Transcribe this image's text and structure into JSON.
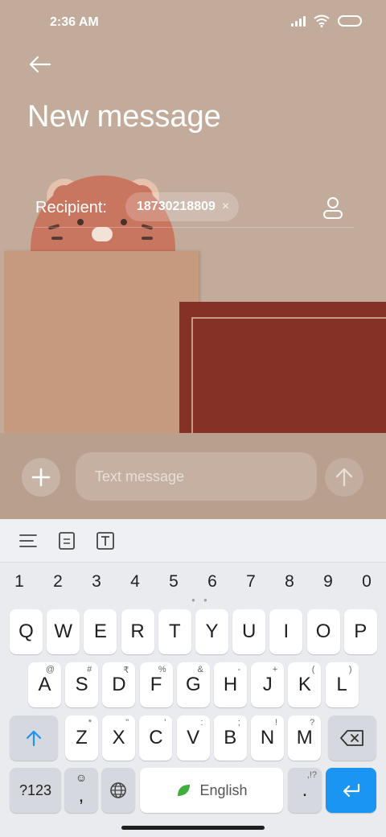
{
  "status_bar": {
    "time": "2:36 AM"
  },
  "header": {
    "title": "New message"
  },
  "recipient": {
    "label": "Recipient:",
    "chip_number": "18730218809",
    "chip_remove": "×"
  },
  "compose": {
    "placeholder": "Text message"
  },
  "keyboard": {
    "numbers": [
      "1",
      "2",
      "3",
      "4",
      "5",
      "6",
      "7",
      "8",
      "9",
      "0"
    ],
    "row1": [
      {
        "label": "Q"
      },
      {
        "label": "W"
      },
      {
        "label": "E"
      },
      {
        "label": "R"
      },
      {
        "label": "T"
      },
      {
        "label": "Y"
      },
      {
        "label": "U"
      },
      {
        "label": "I"
      },
      {
        "label": "O"
      },
      {
        "label": "P"
      }
    ],
    "row2": [
      {
        "label": "A",
        "sub": "@"
      },
      {
        "label": "S",
        "sub": "#"
      },
      {
        "label": "D",
        "sub": "₹"
      },
      {
        "label": "F",
        "sub": "%"
      },
      {
        "label": "G",
        "sub": "&"
      },
      {
        "label": "H",
        "sub": "-"
      },
      {
        "label": "J",
        "sub": "+"
      },
      {
        "label": "K",
        "sub": "("
      },
      {
        "label": "L",
        "sub": ")"
      }
    ],
    "row3": [
      {
        "label": "Z",
        "sub": "*"
      },
      {
        "label": "X",
        "sub": "\""
      },
      {
        "label": "C",
        "sub": "'"
      },
      {
        "label": "V",
        "sub": ":"
      },
      {
        "label": "B",
        "sub": ";"
      },
      {
        "label": "N",
        "sub": "!"
      },
      {
        "label": "M",
        "sub": "?"
      }
    ],
    "symbols_label": "?123",
    "comma_label": ",",
    "space_label": "English",
    "period_label": ".",
    "period_sub": ",!?"
  },
  "colors": {
    "accent": "#1a96f2",
    "book": "#853126",
    "background": "#c3ab9b"
  }
}
